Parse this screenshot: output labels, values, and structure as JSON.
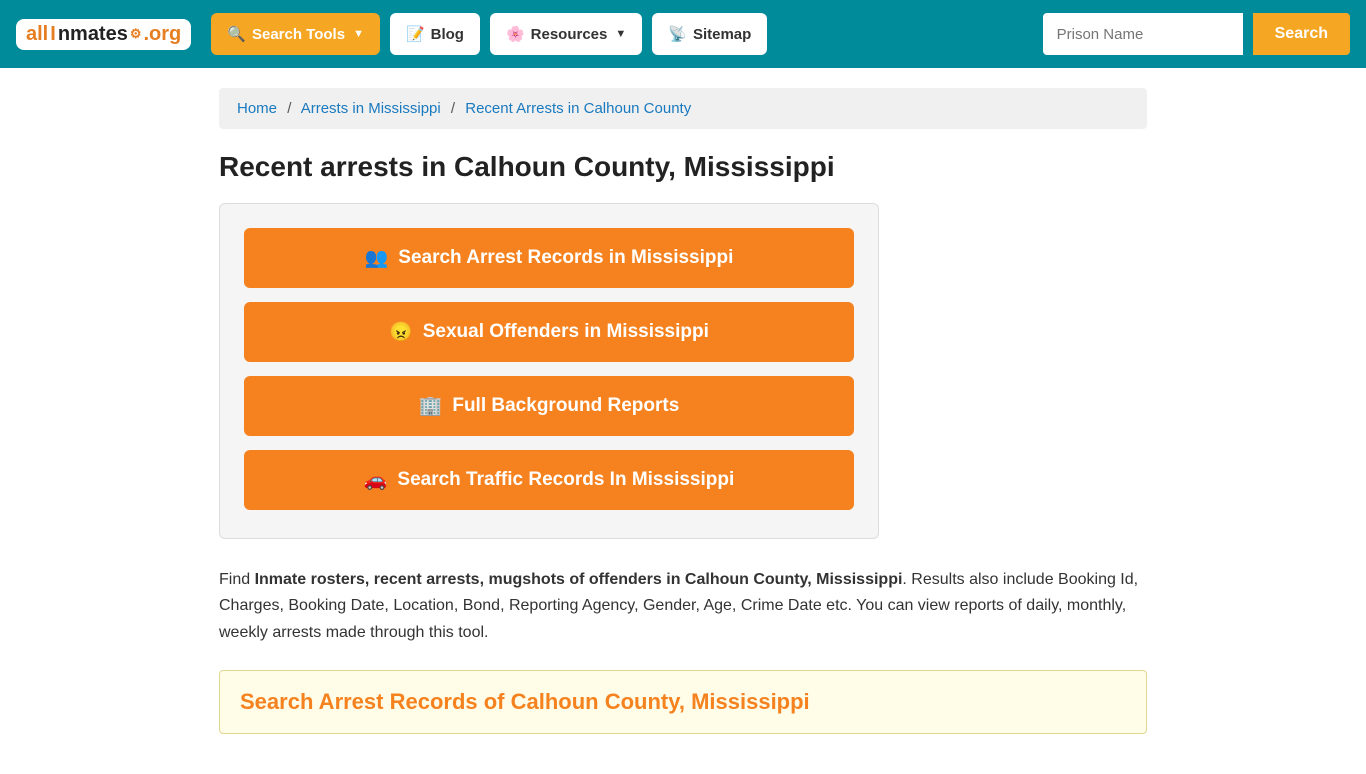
{
  "logo": {
    "all": "all",
    "inmates": "Inmates",
    "org": ".org"
  },
  "navbar": {
    "search_tools_label": "Search Tools",
    "blog_label": "Blog",
    "resources_label": "Resources",
    "sitemap_label": "Sitemap",
    "search_placeholder": "Prison Name",
    "search_button": "Search"
  },
  "breadcrumb": {
    "home": "Home",
    "arrests_ms": "Arrests in Mississippi",
    "current": "Recent Arrests in Calhoun County"
  },
  "page": {
    "title": "Recent arrests in Calhoun County, Mississippi",
    "action_btn_1": "Search Arrest Records in Mississippi",
    "action_btn_2": "Sexual Offenders in Mississippi",
    "action_btn_3": "Full Background Reports",
    "action_btn_4": "Search Traffic Records In Mississippi",
    "description_start": "Find ",
    "description_bold": "Inmate rosters, recent arrests, mugshots of offenders in Calhoun County, Mississippi",
    "description_rest": ". Results also include Booking Id, Charges, Booking Date, Location, Bond, Reporting Agency, Gender, Age, Crime Date etc. You can view reports of daily, monthly, weekly arrests made through this tool.",
    "section_heading": "Search Arrest Records of Calhoun County, Mississippi"
  },
  "icons": {
    "search_tools": "🔍",
    "blog": "📝",
    "resources": "🌸",
    "sitemap": "📡",
    "people": "👥",
    "offender": "😠",
    "building": "🏢",
    "car": "🚗"
  }
}
